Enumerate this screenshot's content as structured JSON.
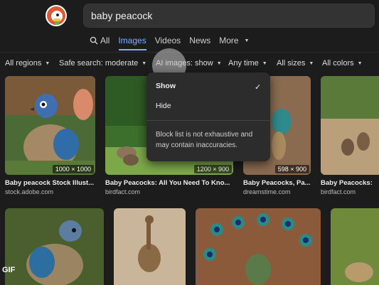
{
  "search": {
    "query": "baby peacock"
  },
  "tabs": [
    {
      "label": "All"
    },
    {
      "label": "Images"
    },
    {
      "label": "Videos"
    },
    {
      "label": "News"
    },
    {
      "label": "More"
    }
  ],
  "filters": {
    "regions": "All regions",
    "safe_search": "Safe search: moderate",
    "ai_images": "AI images: show",
    "time": "Any time",
    "sizes": "All sizes",
    "colors": "All colors"
  },
  "dropdown": {
    "show": "Show",
    "hide": "Hide",
    "note": "Block list is not exhaustive and may contain inaccuracies."
  },
  "results": [
    {
      "caption": "Baby peacock Stock Illust...",
      "source": "stock.adobe.com",
      "size": "1000 × 1000"
    },
    {
      "caption": "Baby Peacocks: All You Need To Kno...",
      "source": "birdfact.com",
      "size": "1200 × 900"
    },
    {
      "caption": "Baby Peacocks, Pa...",
      "source": "dreamstime.com",
      "size": "598 × 900"
    },
    {
      "caption": "Baby Peacocks:",
      "source": "birdfact.com",
      "size": ""
    }
  ],
  "gif_label": "GIF",
  "colors": {
    "background": "#1c1c1c",
    "accent": "#7ab3ff",
    "logo": "#de5833"
  }
}
